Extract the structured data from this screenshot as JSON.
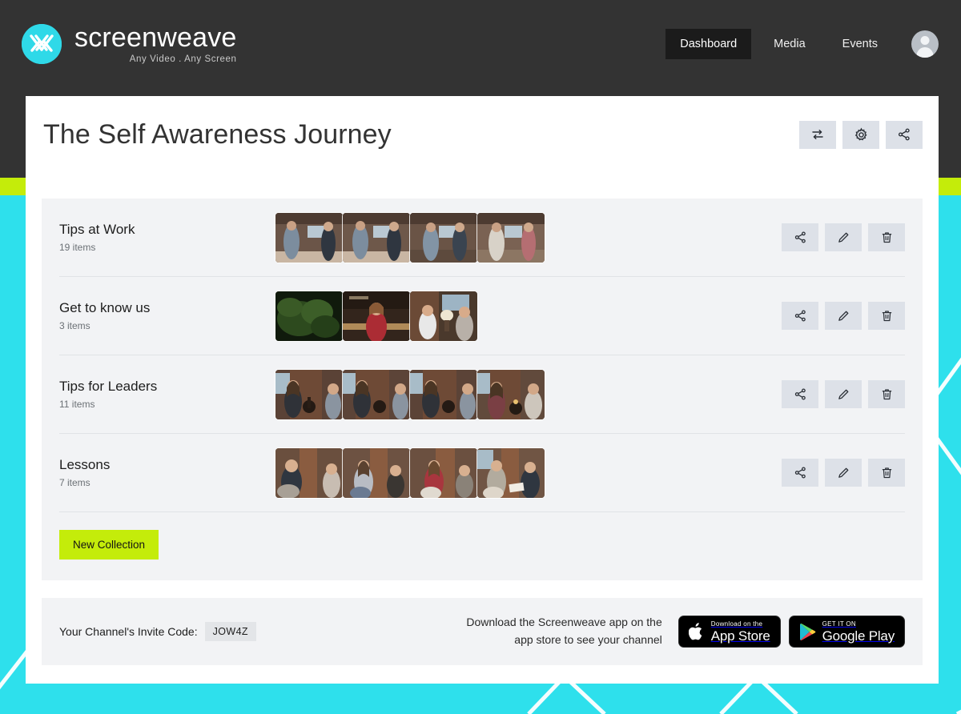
{
  "brand": {
    "name": "screenweave",
    "tagline": "Any Video . Any Screen",
    "logo_icon": "screenweave-weave-logo",
    "logo_color": "#2fd9e8"
  },
  "nav": {
    "items": [
      {
        "label": "Dashboard",
        "active": true
      },
      {
        "label": "Media",
        "active": false
      },
      {
        "label": "Events",
        "active": false
      }
    ],
    "avatar_icon": "user-avatar-icon"
  },
  "header": {
    "title": "The Self Awareness Journey",
    "actions": [
      {
        "name": "reorder-button",
        "icon": "transfer-arrows-icon"
      },
      {
        "name": "settings-button",
        "icon": "gear-icon"
      },
      {
        "name": "share-button",
        "icon": "share-nodes-icon"
      }
    ]
  },
  "collections": [
    {
      "title": "Tips at Work",
      "count": "19 items",
      "thumb_count": 4,
      "thumbs": [
        "#6e584a",
        "#715a4b",
        "#6a5446",
        "#7a6253"
      ]
    },
    {
      "title": "Get to know us",
      "count": "3 items",
      "thumb_count": 3,
      "thumbs": [
        "#243218",
        "#4a3228",
        "#5e4a3c"
      ]
    },
    {
      "title": "Tips for Leaders",
      "count": "11 items",
      "thumb_count": 4,
      "thumbs": [
        "#5a4236",
        "#5c4438",
        "#5b4337",
        "#614a3c"
      ]
    },
    {
      "title": "Lessons",
      "count": "7 items",
      "thumb_count": 4,
      "thumbs": [
        "#6a4f3e",
        "#6d5242",
        "#6b5040",
        "#705544"
      ]
    }
  ],
  "row_actions": [
    {
      "name": "share-collection-button",
      "icon": "share-nodes-icon"
    },
    {
      "name": "edit-collection-button",
      "icon": "pencil-icon"
    },
    {
      "name": "delete-collection-button",
      "icon": "trash-icon"
    }
  ],
  "new_collection": {
    "label": "New Collection",
    "color": "#c4ec0a"
  },
  "footer": {
    "invite_label": "Your Channel's Invite Code:",
    "invite_code": "JOW4Z",
    "download_line1": "Download the Screenweave app on the",
    "download_line2": "app store to see your channel",
    "app_store": {
      "small": "Download on the",
      "big": "App Store",
      "icon": "apple-logo-icon"
    },
    "google_play": {
      "small": "GET IT ON",
      "big": "Google Play",
      "icon": "google-play-triangle-icon"
    }
  },
  "theme": {
    "background_cyan": "#2ee0ec",
    "dark_band": "#333333",
    "lime_accent": "#c4ec0a",
    "panel_gray": "#f2f3f5",
    "button_gray": "#dde1e8"
  }
}
